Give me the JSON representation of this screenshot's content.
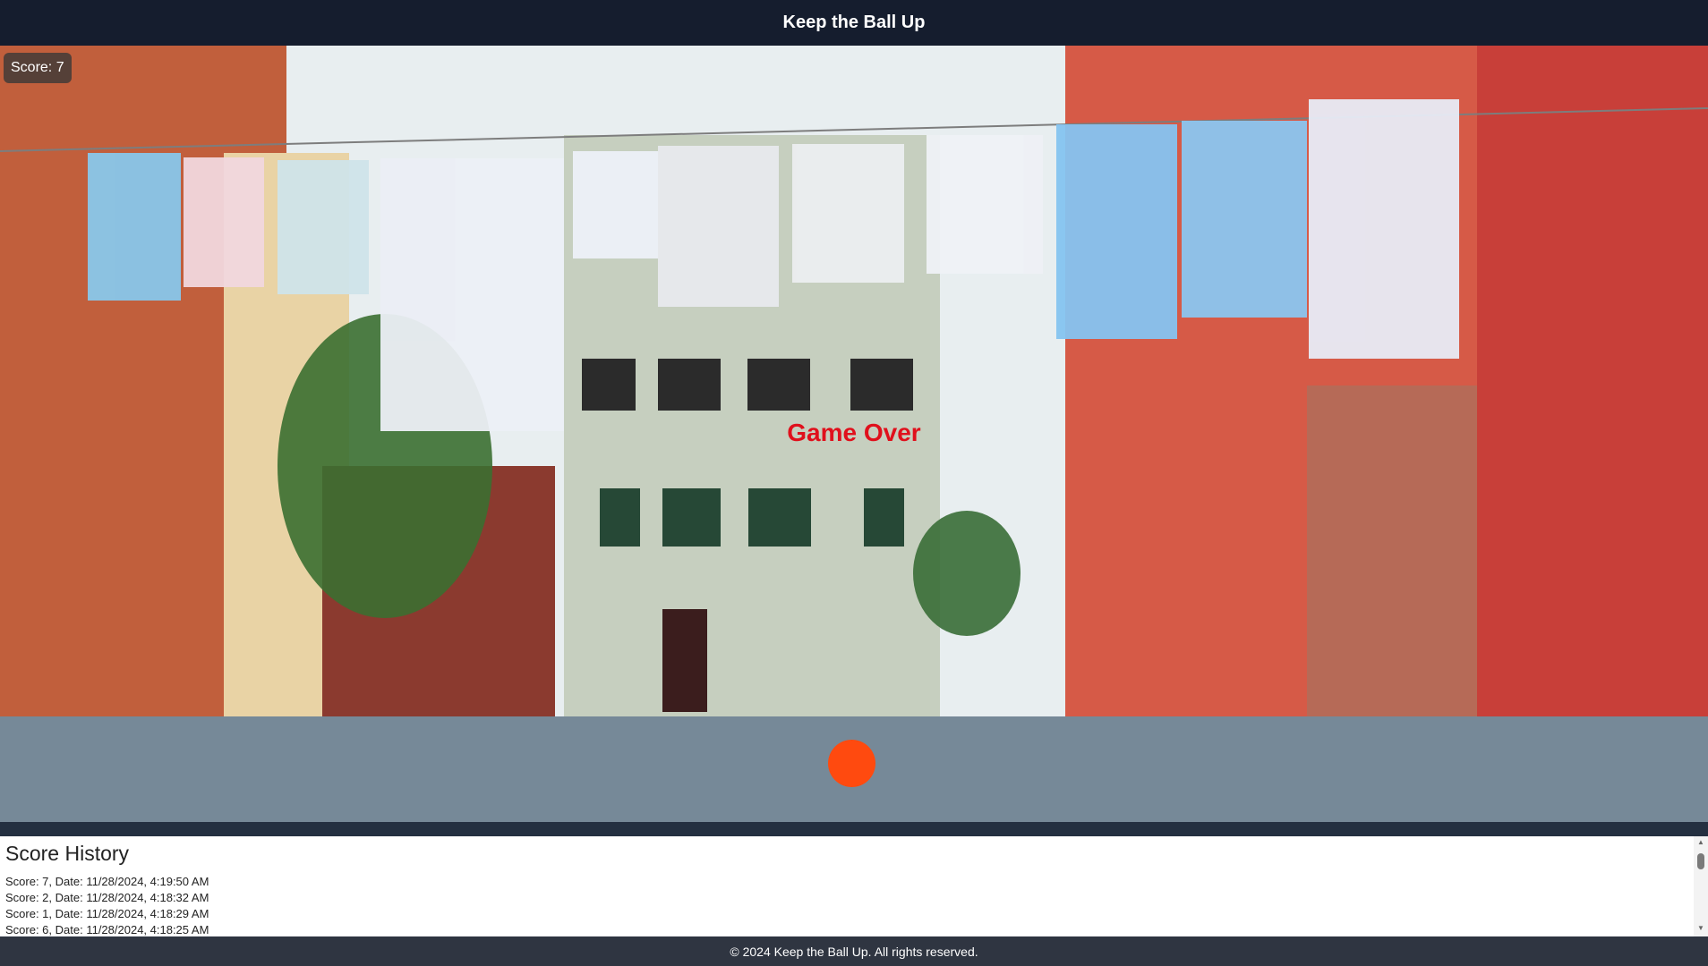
{
  "app": {
    "title": "Keep the Ball Up"
  },
  "game": {
    "score_label": "Score: 7",
    "status": "Game Over",
    "ball_color": "#ff4a0f"
  },
  "history": {
    "title": "Score History",
    "items": [
      "Score: 7, Date: 11/28/2024, 4:19:50 AM",
      "Score: 2, Date: 11/28/2024, 4:18:32 AM",
      "Score: 1, Date: 11/28/2024, 4:18:29 AM",
      "Score: 6, Date: 11/28/2024, 4:18:25 AM"
    ]
  },
  "footer": {
    "text": "© 2024 Keep the Ball Up. All rights reserved."
  },
  "colors": {
    "accent": "#e0101c",
    "header": "#151d2e"
  }
}
